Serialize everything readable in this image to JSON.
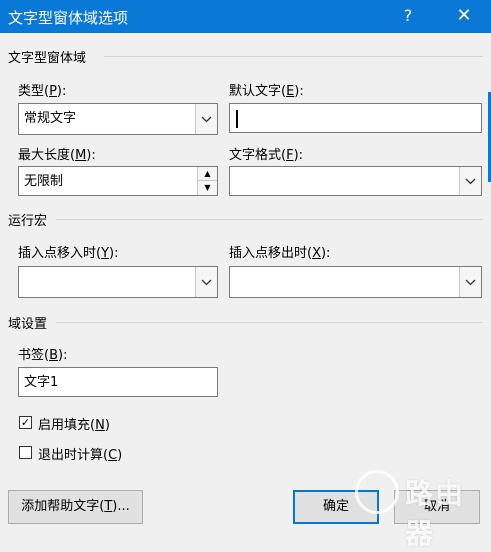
{
  "window": {
    "title": "文字型窗体域选项",
    "help": "?",
    "close": "✕"
  },
  "groups": {
    "field": "文字型窗体域",
    "macro": "运行宏",
    "settings": "域设置"
  },
  "labels": {
    "type": {
      "pre": "类型(",
      "key": "P",
      "post": "):"
    },
    "default_text": {
      "pre": "默认文字(",
      "key": "E",
      "post": "):"
    },
    "max_length": {
      "pre": "最大长度(",
      "key": "M",
      "post": "):"
    },
    "text_format": {
      "pre": "文字格式(",
      "key": "F",
      "post": "):"
    },
    "on_entry": {
      "pre": "插入点移入时(",
      "key": "Y",
      "post": "):"
    },
    "on_exit": {
      "pre": "插入点移出时(",
      "key": "X",
      "post": "):"
    },
    "bookmark": {
      "pre": "书签(",
      "key": "B",
      "post": "):"
    }
  },
  "fields": {
    "type_value": "常规文字",
    "default_text_value": "",
    "max_length_value": "无限制",
    "text_format_value": "",
    "on_entry_value": "",
    "on_exit_value": "",
    "bookmark_value": "文字1"
  },
  "checkboxes": {
    "fill_in": {
      "pre": "启用填充(",
      "key": "N",
      "post": ")",
      "checked": true,
      "mark": "✓"
    },
    "calc_on_exit": {
      "pre": "退出时计算(",
      "key": "C",
      "post": ")",
      "checked": false,
      "mark": ""
    }
  },
  "buttons": {
    "add_help": {
      "pre": "添加帮助文字(",
      "key": "T",
      "post": ")..."
    },
    "ok": "确定",
    "cancel": "取消"
  },
  "watermark": {
    "text": "路由器"
  }
}
